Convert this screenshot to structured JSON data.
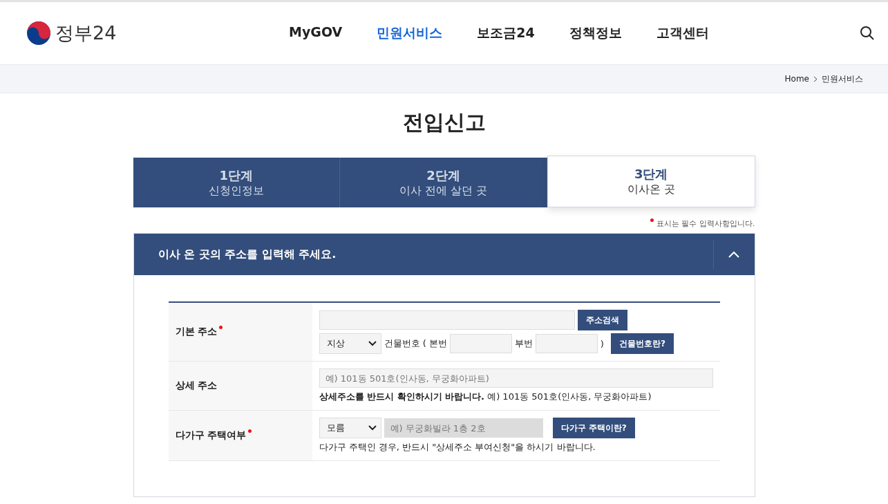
{
  "header": {
    "logo_text": "정부24",
    "nav": [
      {
        "label": "MyGOV",
        "selected": false
      },
      {
        "label": "민원서비스",
        "selected": true
      },
      {
        "label": "보조금24",
        "selected": false
      },
      {
        "label": "정책정보",
        "selected": false
      },
      {
        "label": "고객센터",
        "selected": false
      }
    ]
  },
  "breadcrumb": [
    "Home",
    "민원서비스"
  ],
  "title": "전입신고",
  "steps": [
    {
      "step": "1단계",
      "label": "신청인정보",
      "selected": false
    },
    {
      "step": "2단계",
      "label": "이사 전에 살던 곳",
      "selected": false
    },
    {
      "step": "3단계",
      "label": "이사온 곳",
      "selected": true
    }
  ],
  "required_note": "표시는 필수 입력사항입니다.",
  "section": {
    "title": "이사 온 곳의 주소를 입력해 주세요.",
    "expanded": true
  },
  "basic_address": {
    "label": "기본 주소",
    "required": true,
    "search_button": "주소검색",
    "select_value": "지상",
    "building_label": "건물번호 ( 본번",
    "sub_label": "부번",
    "close_paren": ")",
    "help_button": "건물번호란?"
  },
  "detail_address": {
    "label": "상세 주소",
    "required": false,
    "placeholder": "예) 101동 501호(인사동, 무궁화아파트)",
    "note": "**상세주소를 반드시 확인하시기 바랍니다.** 예) 101동 501호(인사동, 무궁화아파트)"
  },
  "multi_household": {
    "label": "다가구 주택여부",
    "required": true,
    "select_value": "모름",
    "placeholder": "예) 무궁화빌라 1층 2호",
    "disabled": true,
    "help_button": "다가구 주택이란?",
    "note": "다가구 주택인 경우, 반드시 \"상세주소 부여신청\"을 하시기 바랍니다."
  }
}
